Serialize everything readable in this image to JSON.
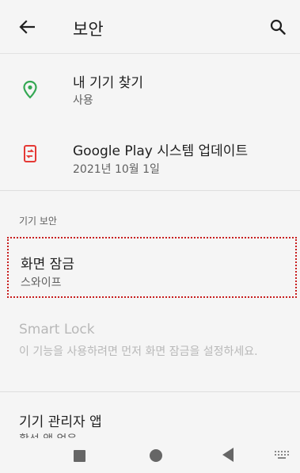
{
  "appbar": {
    "title": "보안",
    "back_icon": "arrow-left-icon",
    "search_icon": "search-icon"
  },
  "find_device": {
    "title": "내 기기 찾기",
    "status": "사용",
    "icon": "location-pin-icon",
    "icon_color": "#34a853"
  },
  "system_update": {
    "title": "Google Play 시스템 업데이트",
    "date": "2021년 10월 1일",
    "icon": "system-update-icon",
    "icon_color": "#e53935"
  },
  "device_security": {
    "header": "기기 보안",
    "screen_lock": {
      "title": "화면 잠금",
      "value": "스와이프"
    },
    "smart_lock": {
      "title": "Smart Lock",
      "description": "이 기능을 사용하려면 먼저 화면 잠금을 설정하세요."
    },
    "device_admin": {
      "title": "기기 관리자 앱",
      "value": "활성 앱 없음"
    }
  },
  "navbar": {
    "recents_icon": "square-icon",
    "home_icon": "circle-icon",
    "back_icon": "triangle-back-icon",
    "keyboard_icon": "keyboard-icon"
  }
}
